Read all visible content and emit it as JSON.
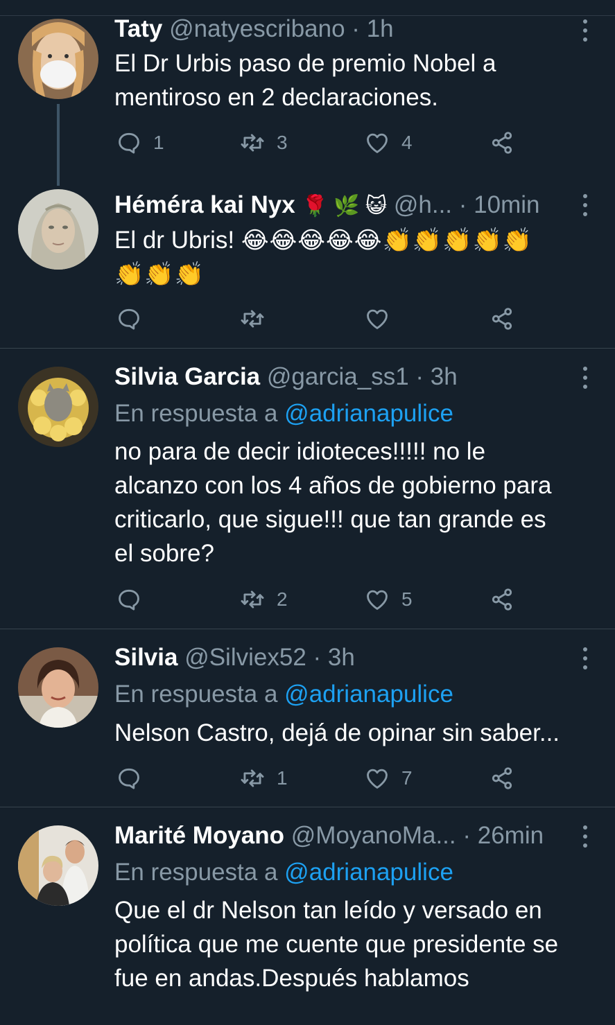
{
  "tweets": [
    {
      "name": "Taty",
      "handle": "@natyescribano",
      "dot": "·",
      "time": "1h",
      "text_lines": [
        "El Dr Urbis paso de premio Nobel a",
        "mentiroso en 2 declaraciones."
      ],
      "counts": {
        "reply": "1",
        "retweet": "3",
        "like": "4"
      }
    },
    {
      "name": "Héméra kai Nyx",
      "name_emoji": "🌹 🌿 😺",
      "handle": "@h...",
      "dot": "·",
      "time": "10min",
      "text_prefix": "El dr Ubris!",
      "emoji_line1": "😂😂😂😂😂👏👏👏👏👏",
      "emoji_line2": "👏👏👏",
      "counts": {
        "reply": "",
        "retweet": "",
        "like": ""
      }
    },
    {
      "name": "Silvia Garcia",
      "handle": "@garcia_ss1",
      "dot": "·",
      "time": "3h",
      "reply_prefix": "En respuesta a",
      "reply_to": "@adrianapulice",
      "text_lines": [
        "no para de decir idioteces!!!!! no le",
        "alcanzo con los 4 años de gobierno para",
        "criticarlo, que sigue!!! que tan grande es",
        "el sobre?"
      ],
      "counts": {
        "reply": "",
        "retweet": "2",
        "like": "5"
      }
    },
    {
      "name": "Silvia",
      "handle": "@Silviex52",
      "dot": "·",
      "time": "3h",
      "reply_prefix": "En respuesta a",
      "reply_to": "@adrianapulice",
      "text_lines": [
        "Nelson Castro, dejá de opinar sin saber..."
      ],
      "counts": {
        "reply": "",
        "retweet": "1",
        "like": "7"
      }
    },
    {
      "name": "Marité Moyano",
      "handle": "@MoyanoMa...",
      "dot": "·",
      "time": "26min",
      "reply_prefix": "En respuesta a",
      "reply_to": "@adrianapulice",
      "text_lines": [
        "Que el dr Nelson tan leído y versado en",
        "política que me cuente que presidente se",
        "fue en andas.Después hablamos"
      ]
    }
  ],
  "icons": {
    "reply": "reply-icon",
    "retweet": "retweet-icon",
    "like": "heart-icon",
    "share": "share-icon",
    "more": "more-vertical-icon"
  },
  "colors": {
    "background": "#15202b",
    "secondary_text": "#8899a6",
    "link": "#1da1f2",
    "divider": "#38444d"
  }
}
